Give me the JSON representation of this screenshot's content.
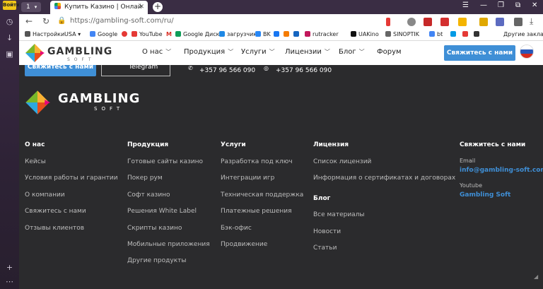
{
  "browser": {
    "profile_label": "Войти",
    "tab_count": "1",
    "tab_title": "Купить Казино | Онлай",
    "url": "https://gambling-soft.com/ru/",
    "other_bookmarks": "Другие закладки",
    "bookmarks": [
      "Настройки",
      "USA",
      "Google",
      "YouTube",
      "Google Диск",
      "загрузчик",
      "BK",
      "rutracker",
      "UAKino",
      "SINOPTIK",
      "bt"
    ]
  },
  "header": {
    "logo_word": "GAMBLING",
    "logo_sub": "SOFT",
    "menu": [
      "О нас",
      "Продукция",
      "Услуги",
      "Лицензии",
      "Блог",
      "Форум"
    ],
    "contact_button": "Свяжитесь с нами"
  },
  "contact_strip": {
    "contact_button": "Свяжитесь с нами",
    "telegram": "Telegram",
    "phone1": "+357 96 566 090",
    "phone2": "+357 96 566 090"
  },
  "footer": {
    "logo_word": "GAMBLING",
    "logo_sub": "SOFT",
    "columns": {
      "about": {
        "title": "О нас",
        "links": [
          "Кейсы",
          "Условия работы и гарантии",
          "О компании",
          "Свяжитесь с нами",
          "Отзывы клиентов"
        ]
      },
      "products": {
        "title": "Продукция",
        "links": [
          "Готовые сайты казино",
          "Покер рум",
          "Софт казино",
          "Решения White Label",
          "Скрипты казино",
          "Мобильные приложения",
          "Другие продукты"
        ]
      },
      "services": {
        "title": "Услуги",
        "links": [
          "Разработка под ключ",
          "Интеграции игр",
          "Техническая поддержка",
          "Платежные решения",
          "Бэк-офис",
          "Продвижение"
        ]
      },
      "license": {
        "title": "Лицензия",
        "links": [
          "Список лицензий",
          "Информация о сертификатах и договорах"
        ]
      },
      "blog": {
        "title": "Блог",
        "links": [
          "Все материалы",
          "Новости",
          "Статьи"
        ]
      },
      "contact": {
        "title": "Свяжитесь с нами",
        "email_label": "Email",
        "email": "info@gambling-soft.com",
        "youtube_label": "Youtube",
        "youtube": "Gambling Soft"
      }
    }
  },
  "colors": {
    "accent": "#3f8fd6",
    "footer_bg": "#2b2b2d",
    "link": "#bdbdbd"
  },
  "icons": [
    "back-icon",
    "reload-icon",
    "download-icon",
    "telegram-icon",
    "phone-icon",
    "whatsapp-icon",
    "russian-flag-icon"
  ]
}
